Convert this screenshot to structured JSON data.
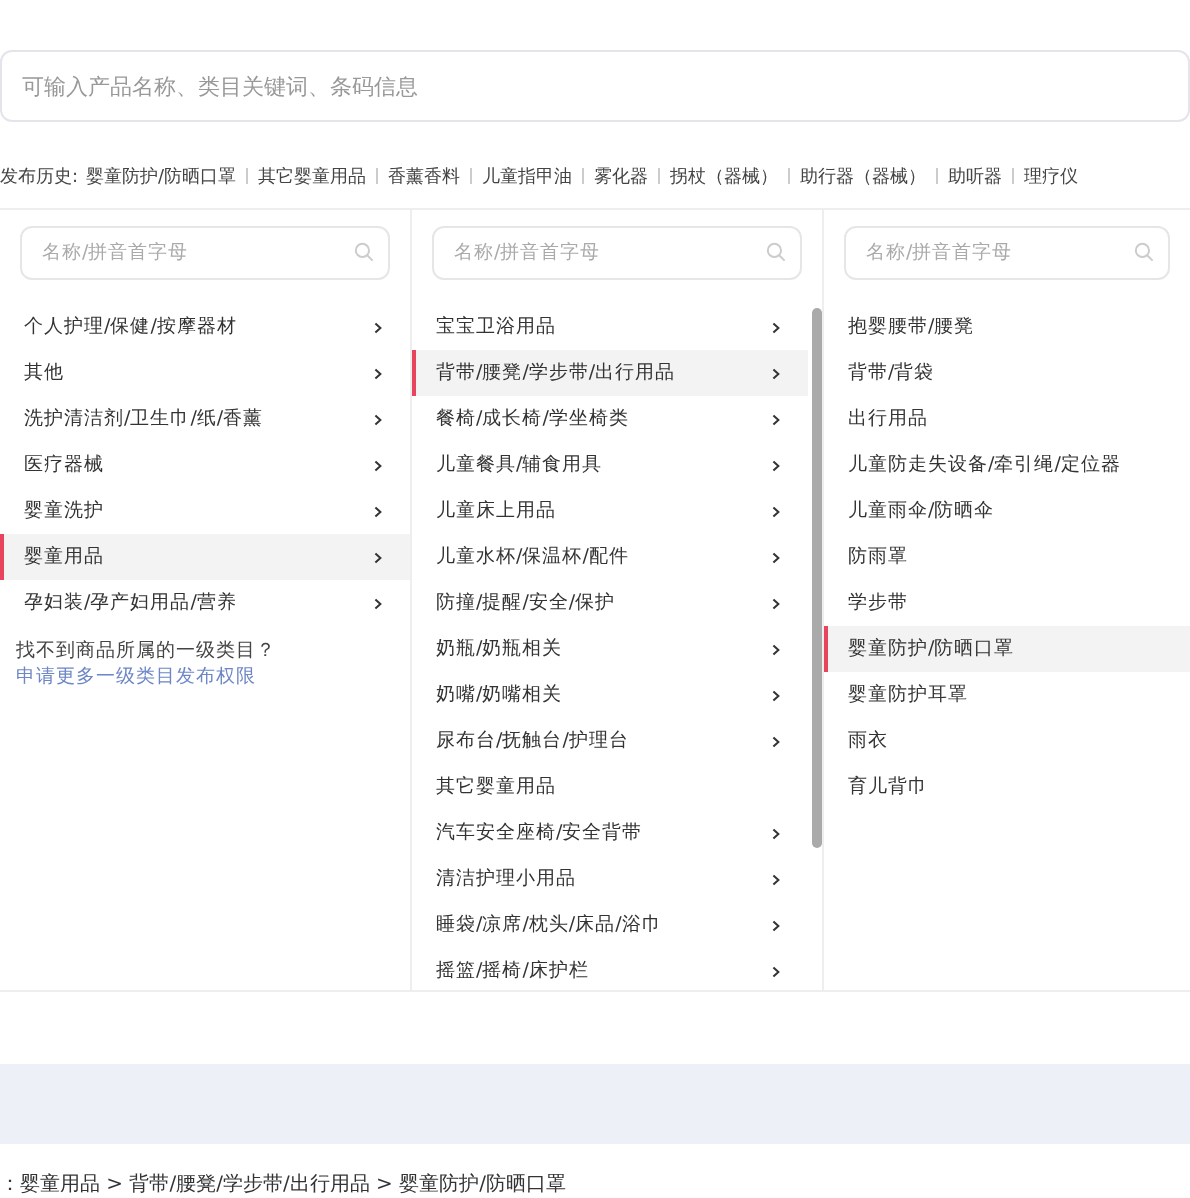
{
  "search": {
    "placeholder": "可输入产品名称、类目关键词、条码信息"
  },
  "history": {
    "label": "发布历史:",
    "items": [
      "婴童防护/防晒口罩",
      "其它婴童用品",
      "香薰香料",
      "儿童指甲油",
      "雾化器",
      "拐杖（器械）",
      "助行器（器械）",
      "助听器",
      "理疗仪"
    ]
  },
  "columns": [
    {
      "placeholder": "名称/拼音首字母",
      "scrollbar": false,
      "items": [
        {
          "label": "个人护理/保健/按摩器材",
          "expandable": true,
          "selected": false
        },
        {
          "label": "其他",
          "expandable": true,
          "selected": false
        },
        {
          "label": "洗护清洁剂/卫生巾/纸/香薰",
          "expandable": true,
          "selected": false
        },
        {
          "label": "医疗器械",
          "expandable": true,
          "selected": false
        },
        {
          "label": "婴童洗护",
          "expandable": true,
          "selected": false
        },
        {
          "label": "婴童用品",
          "expandable": true,
          "selected": true
        },
        {
          "label": "孕妇装/孕产妇用品/营养",
          "expandable": true,
          "selected": false
        }
      ],
      "note": {
        "text": "找不到商品所属的一级类目？",
        "link": "申请更多一级类目发布权限"
      }
    },
    {
      "placeholder": "名称/拼音首字母",
      "scrollbar": true,
      "items": [
        {
          "label": "宝宝卫浴用品",
          "expandable": true,
          "selected": false
        },
        {
          "label": "背带/腰凳/学步带/出行用品",
          "expandable": true,
          "selected": true
        },
        {
          "label": "餐椅/成长椅/学坐椅类",
          "expandable": true,
          "selected": false
        },
        {
          "label": "儿童餐具/辅食用具",
          "expandable": true,
          "selected": false
        },
        {
          "label": "儿童床上用品",
          "expandable": true,
          "selected": false
        },
        {
          "label": "儿童水杯/保温杯/配件",
          "expandable": true,
          "selected": false
        },
        {
          "label": "防撞/提醒/安全/保护",
          "expandable": true,
          "selected": false
        },
        {
          "label": "奶瓶/奶瓶相关",
          "expandable": true,
          "selected": false
        },
        {
          "label": "奶嘴/奶嘴相关",
          "expandable": true,
          "selected": false
        },
        {
          "label": "尿布台/抚触台/护理台",
          "expandable": true,
          "selected": false
        },
        {
          "label": "其它婴童用品",
          "expandable": false,
          "selected": false
        },
        {
          "label": "汽车安全座椅/安全背带",
          "expandable": true,
          "selected": false
        },
        {
          "label": "清洁护理小用品",
          "expandable": true,
          "selected": false
        },
        {
          "label": "睡袋/凉席/枕头/床品/浴巾",
          "expandable": true,
          "selected": false
        },
        {
          "label": "摇篮/摇椅/床护栏",
          "expandable": true,
          "selected": false
        }
      ]
    },
    {
      "placeholder": "名称/拼音首字母",
      "scrollbar": false,
      "items": [
        {
          "label": "抱婴腰带/腰凳",
          "expandable": false,
          "selected": false
        },
        {
          "label": "背带/背袋",
          "expandable": false,
          "selected": false
        },
        {
          "label": "出行用品",
          "expandable": false,
          "selected": false
        },
        {
          "label": "儿童防走失设备/牵引绳/定位器",
          "expandable": false,
          "selected": false
        },
        {
          "label": "儿童雨伞/防晒伞",
          "expandable": false,
          "selected": false
        },
        {
          "label": "防雨罩",
          "expandable": false,
          "selected": false
        },
        {
          "label": "学步带",
          "expandable": false,
          "selected": false
        },
        {
          "label": "婴童防护/防晒口罩",
          "expandable": false,
          "selected": true
        },
        {
          "label": "婴童防护耳罩",
          "expandable": false,
          "selected": false
        },
        {
          "label": "雨衣",
          "expandable": false,
          "selected": false
        },
        {
          "label": "育儿背巾",
          "expandable": false,
          "selected": false
        }
      ]
    }
  ],
  "breadcrumb": "：婴童用品 > 背带/腰凳/学步带/出行用品 > 婴童防护/防晒口罩"
}
